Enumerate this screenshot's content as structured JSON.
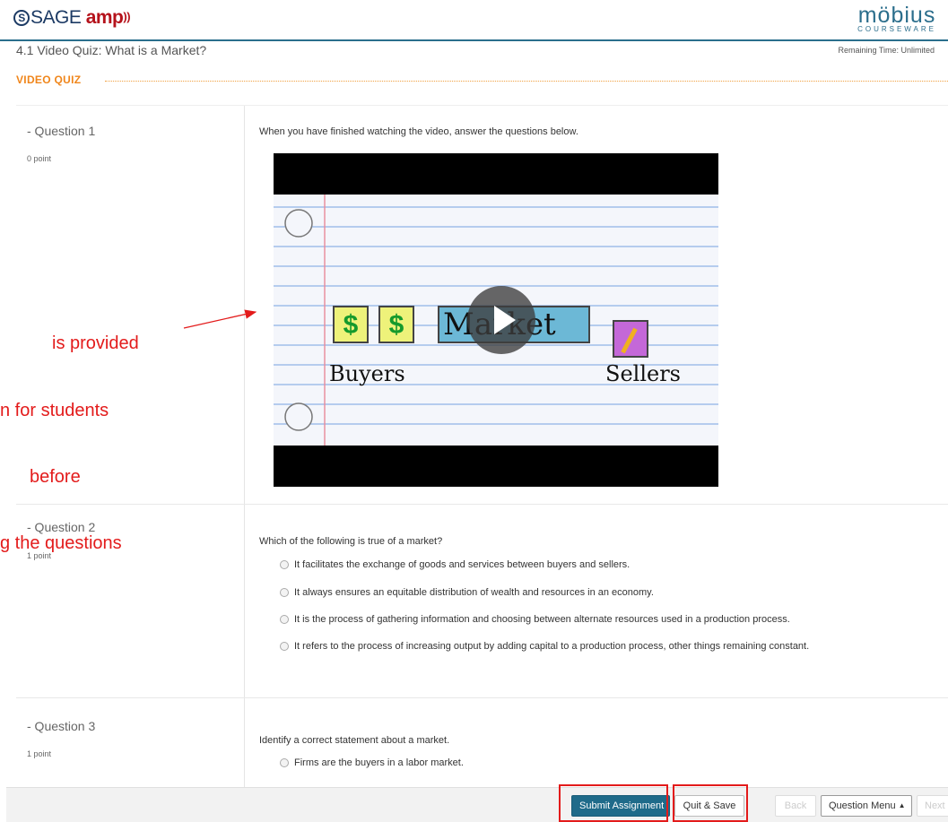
{
  "header": {
    "sage_logo": {
      "circle": "S",
      "sage": "SAGE",
      "amp": "amp",
      "waves": "))"
    },
    "mobius_logo": {
      "word": "möbius",
      "sub": "COURSEWARE"
    }
  },
  "title_bar": {
    "title": "4.1 Video Quiz: What is a Market?",
    "remaining_time": "Remaining Time: Unlimited"
  },
  "section": {
    "heading": "VIDEO QUIZ"
  },
  "questions": [
    {
      "label": "- Question 1",
      "points": "0 point",
      "text": "When you have finished watching the video, answer the questions below.",
      "video": {
        "dollar_sign": "$",
        "market_word": "Market",
        "buyers": "Buyers",
        "sellers": "Sellers"
      }
    },
    {
      "label": "- Question 2",
      "points": "1 point",
      "text": "Which of the following is true of a market?",
      "options": [
        "It facilitates the exchange of goods and services between buyers and sellers.",
        "It always ensures an equitable distribution of wealth and resources in an economy.",
        "It is the process of gathering information and choosing between alternate resources used in a production process.",
        "It refers to the process of increasing output by adding capital to a production process, other things remaining constant."
      ]
    },
    {
      "label": "- Question 3",
      "points": "1 point",
      "text": "Identify a correct statement about a market.",
      "options": [
        "Firms are the buyers in a labor market."
      ]
    }
  ],
  "annotation": {
    "lines": [
      "is provided",
      "n for students",
      "before",
      "g the questions"
    ],
    "color": "#e31b1b"
  },
  "footer": {
    "submit": "Submit Assignment",
    "quit": "Quit & Save",
    "back": "Back",
    "question_menu": "Question Menu",
    "next": "Next"
  },
  "colors": {
    "brand_teal": "#2a6f8d",
    "accent_orange": "#f0861b",
    "submit_bg": "#1f6b8a",
    "highlight_red": "#e31b1b"
  }
}
